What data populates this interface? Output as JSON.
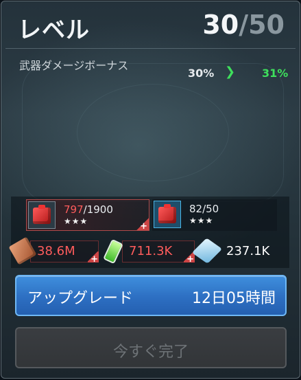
{
  "header": {
    "title": "レベル",
    "level_current": "30",
    "level_separator": "/",
    "level_max": "50"
  },
  "bonus": {
    "label": "武器ダメージボーナス",
    "current": "30%",
    "arrow": "❯",
    "next": "31%"
  },
  "materials": [
    {
      "icon": "red-cube-icon",
      "have": "797",
      "sep": "/",
      "need": "1900",
      "stars": "★★★",
      "plus": "+"
    },
    {
      "icon": "red-cube-icon",
      "value": "82/50",
      "stars": "★★★"
    }
  ],
  "resources": [
    {
      "icon": "copper-ingot-icon",
      "value": "38.6M",
      "plus": "+"
    },
    {
      "icon": "battery-icon",
      "value": "711.3K",
      "plus": "+"
    },
    {
      "icon": "crystal-icon",
      "value": "237.1K"
    }
  ],
  "buttons": {
    "upgrade_label": "アップグレード",
    "upgrade_time": "12日05時間",
    "instant_label": "今すぐ完了"
  },
  "colors": {
    "insufficient": "#ff5c5c",
    "increase": "#3ee05c",
    "primary_button": "#2d6fc2"
  }
}
